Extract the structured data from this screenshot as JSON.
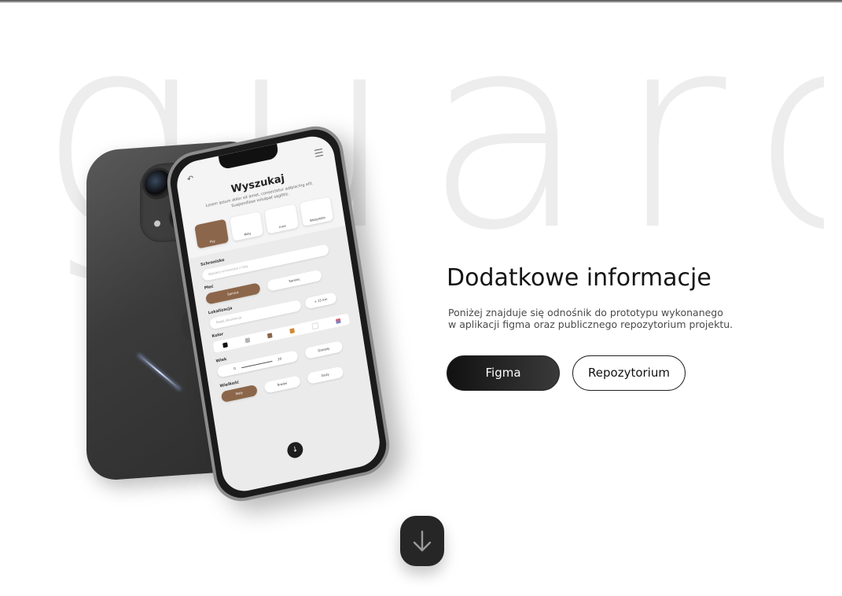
{
  "background_word": "guard",
  "screen": {
    "title": "Wyszukaj",
    "description": "Lorem ipsum dolor sit amet, consectetur adipiscing elit. Suspendisse volutpat sagittis.",
    "categories": [
      "Psy",
      "Koty",
      "Inne",
      "Wszystkie"
    ],
    "shelter_label": "Schronisko",
    "shelter_placeholder": "Wybierz schronisko z listy",
    "sex_label": "Płeć",
    "sex_options": [
      "Samica",
      "Samiec"
    ],
    "location_label": "Lokalizacja",
    "location_placeholder": "Podaj lokalizację",
    "distance": "+ 15 km",
    "color_label": "Kolor",
    "swatch_colors": [
      "#111111",
      "#b3b3b3",
      "#8c664a",
      "#d08a3a",
      "#ffffff",
      "#e85c5c"
    ],
    "age_label": "Wiek",
    "age_min": "0",
    "age_max": "20",
    "age_extra": "Dorosły",
    "size_label": "Wielkość",
    "size_options": [
      "Mały",
      "Średni",
      "Duży"
    ]
  },
  "main": {
    "heading": "Dodatkowe informacje",
    "description_line1": "Poniżej znajduje się odnośnik do prototypu wykonanego",
    "description_line2": "w aplikacji figma oraz publicznego repozytorium projektu.",
    "figma_label": "Figma",
    "repo_label": "Repozytorium"
  },
  "colors": {
    "accent_brown": "#8c664a",
    "primary_dark": "#151515",
    "background_word": "#ededed"
  },
  "icons": {
    "scroll_down": "arrow-down-icon"
  }
}
